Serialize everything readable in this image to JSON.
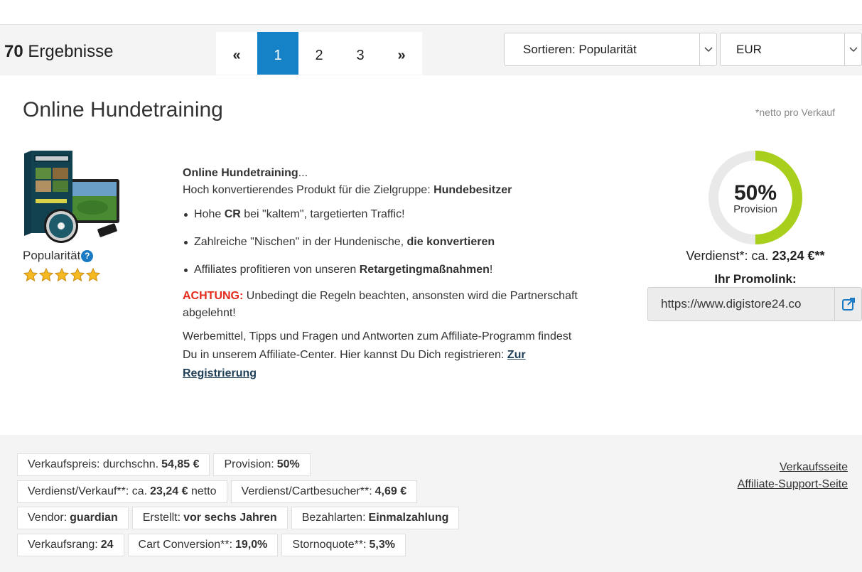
{
  "header": {
    "results_count_num": "70",
    "results_count_text": "Ergebnisse",
    "pagination": [
      {
        "label": "«",
        "active": false
      },
      {
        "label": "1",
        "active": true
      },
      {
        "label": "2",
        "active": false
      },
      {
        "label": "3",
        "active": false
      },
      {
        "label": "»",
        "active": false
      }
    ],
    "sort_select": "Sortieren: Popularität",
    "currency_select": "EUR"
  },
  "product": {
    "title": "Online Hundetraining",
    "netto_note": "*netto pro Verkauf",
    "popularity_label": "Popularität",
    "popularity_stars": 5,
    "desc_title": "Online Hundetraining",
    "desc_title_suffix": "...",
    "desc_intro": "Hoch konvertierendes Produkt für die Zielgruppe: ",
    "desc_intro_bold": "Hundebesitzer",
    "bullets": [
      {
        "pre": "Hohe ",
        "bold": "CR",
        "post": " bei \"kaltem\", targetierten Traffic!"
      },
      {
        "pre": "Zahlreiche \"Nischen\" in der Hundenische, ",
        "bold": "die konvertieren",
        "post": ""
      },
      {
        "pre": "Affiliates profitieren von unseren ",
        "bold": "Retargetingmaßnahmen",
        "post": "!"
      }
    ],
    "achtung_label": "ACHTUNG:",
    "achtung_text": " Unbedingt die Regeln beachten, ansonsten wird die Partnerschaft abgelehnt!",
    "affiliate_text": "Werbemittel, Tipps und Fragen und Antworten zum Affiliate-Programm findest Du in unserem Affiliate-Center. Hier kannst Du Dich registrieren: ",
    "registration_link": "Zur Registrierung",
    "commission_pct": "50%",
    "commission_fraction": 0.5,
    "commission_label": "Provision",
    "earning_prefix": "Verdienst*: ca. ",
    "earning_value": "23,24 €**",
    "promolink_label": "Ihr Promolink:",
    "promolink_value": "https://www.digistore24.co"
  },
  "stats": {
    "rows": [
      [
        {
          "label": "Verkaufspreis: durchschn.",
          "value": "54,85 €"
        },
        {
          "label": "Provision:",
          "value": "50%"
        }
      ],
      [
        {
          "label": "Verdienst/Verkauf**: ca.",
          "value": "23,24 €",
          "suffix": " netto"
        },
        {
          "label": "Verdienst/Cartbesucher**:",
          "value": "4,69 €"
        }
      ],
      [
        {
          "label": "Vendor:",
          "value": "guardian"
        },
        {
          "label": "Erstellt:",
          "value": "vor sechs Jahren"
        },
        {
          "label": "Bezahlarten:",
          "value": "Einmalzahlung"
        }
      ],
      [
        {
          "label": "Verkaufsrang:",
          "value": "24"
        },
        {
          "label": "Cart Conversion**:",
          "value": "19,0%"
        },
        {
          "label": "Stornoquote**:",
          "value": "5,3%"
        }
      ]
    ],
    "links": [
      "Verkaufsseite",
      "Affiliate-Support-Seite"
    ]
  },
  "colors": {
    "accent": "#1582c8",
    "donut_fill": "#a8cf1b",
    "donut_track": "#e9e9e9",
    "warning": "#e42a1d",
    "star": "#f5b921"
  },
  "icons": {
    "help": "question-circle-icon",
    "external": "external-link-icon",
    "star": "star-icon",
    "chevron": "chevron-down-icon"
  }
}
